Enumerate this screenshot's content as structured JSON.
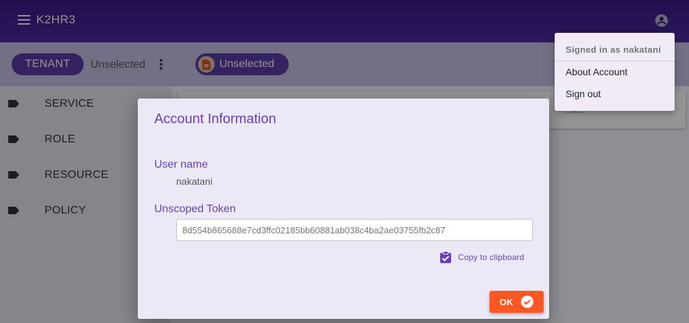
{
  "app": {
    "title": "K2HR3"
  },
  "icons": {
    "menu": "menu-icon",
    "account": "account-circle-icon",
    "more": "more-vertical-icon",
    "service_chip": "document-icon",
    "sidebar_items": "label-tag-icon",
    "copy": "clipboard-check-icon",
    "ok": "check-circle-icon"
  },
  "colors": {
    "appbar": "#3b1a8a",
    "accent": "#6a3fb5",
    "ok_button": "#ff5722",
    "chip": "#5b3ca8"
  },
  "toolbar": {
    "tenant_label": "TENANT",
    "tenant_value": "Unselected",
    "service_label": "Unselected"
  },
  "sidebar": {
    "items": [
      {
        "label": "SERVICE"
      },
      {
        "label": "ROLE"
      },
      {
        "label": "RESOURCE"
      },
      {
        "label": "POLICY"
      }
    ]
  },
  "main": {
    "partial_text": "...r..."
  },
  "dialog": {
    "title": "Account Information",
    "username_label": "User name",
    "username": "nakatani",
    "token_label": "Unscoped Token",
    "token_value": "8d554b865688e7cd3ffc02185bb60881ab038c4ba2ae03755fb2c87",
    "copy_label": "Copy to clipboard",
    "ok_label": "OK"
  },
  "account_menu": {
    "header": "Signed in as nakatani",
    "items": [
      {
        "label": "About Account"
      },
      {
        "label": "Sign out"
      }
    ]
  }
}
